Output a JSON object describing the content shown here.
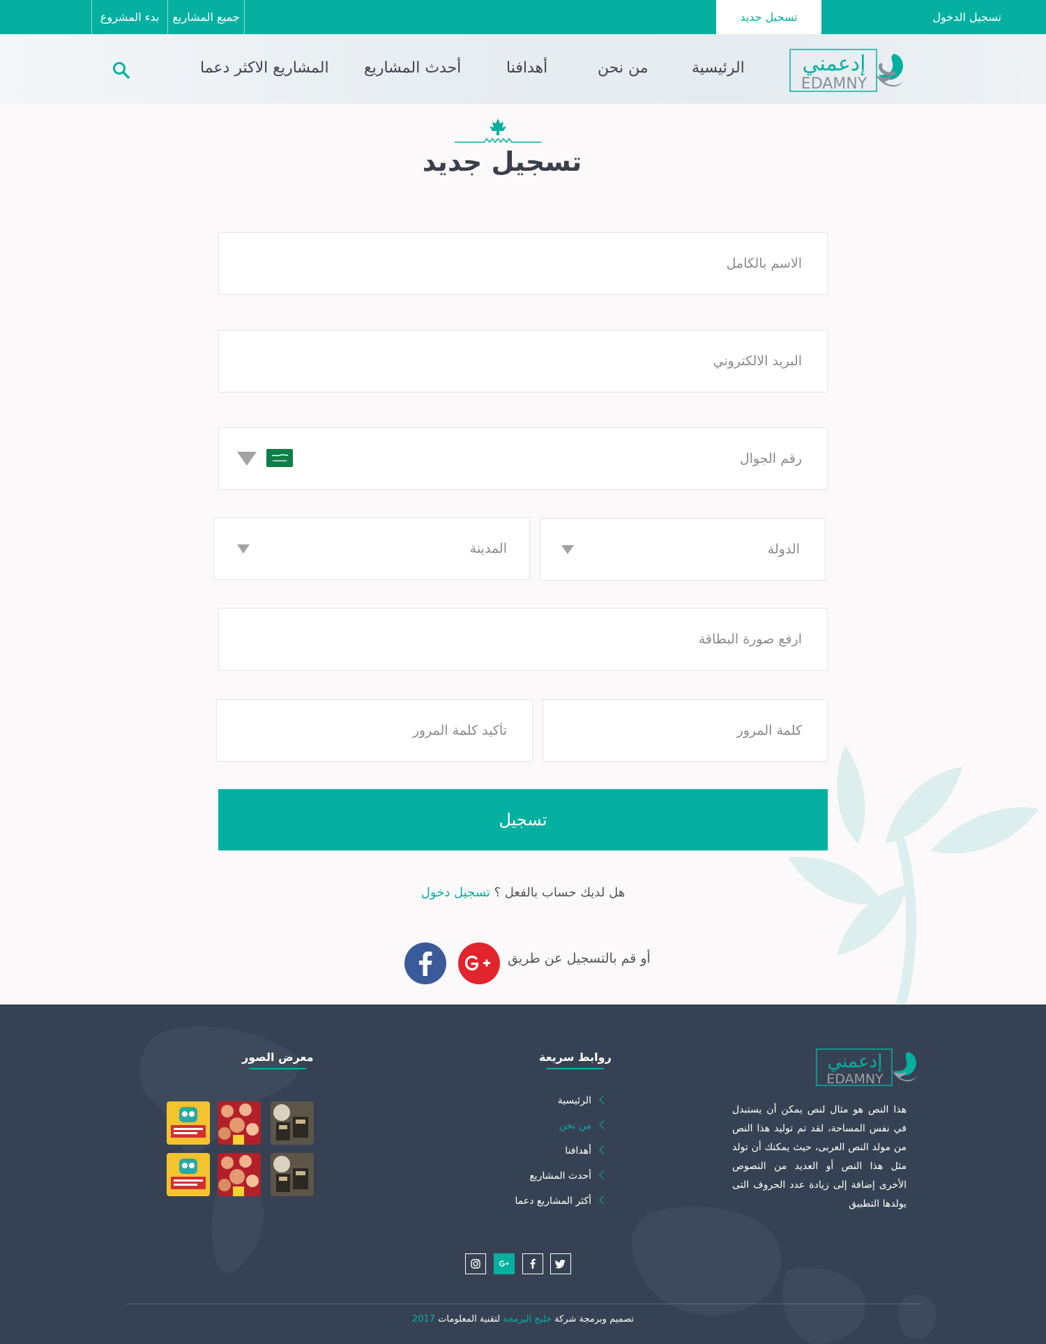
{
  "topbar": {
    "login": "تسجيل الدخول",
    "register": "تسجيل جديد",
    "all_projects": "جميع المشاريع",
    "start_project": "بدء المشروع"
  },
  "brand": {
    "arabic": "إدعمني",
    "latin": "EDAMNY"
  },
  "nav": {
    "home": "الرئيسية",
    "about": "من نحن",
    "goals": "أهدافنا",
    "latest": "أحدث المشاريع",
    "most_supported": "المشاريع الاكثر دعما"
  },
  "form": {
    "title": "تسجيل جديد",
    "full_name": "الاسم بالكامل",
    "email": "البريد الالكتروني",
    "mobile": "رقم الجوال",
    "country": "الدولة",
    "city": "المدينة",
    "upload_card": "ارفع صورة البطاقة",
    "password": "كلمة المرور",
    "confirm_password": "تأكيد كلمة المرور",
    "submit": "تسجيل",
    "have_account": "هل لديك حساب بالفعل ؟",
    "login_link": "تسجيل دخول",
    "social_text": "أو قم بالتسجيل عن طريق"
  },
  "colors": {
    "accent": "#06b0a1",
    "footer_bg": "#364253",
    "google": "#e2242d",
    "facebook": "#3b5a9a"
  },
  "footer": {
    "about_text": "هذا النص هو مثال لنص يمكن أن يستبدل في نفس المساحة، لقد تم توليد هذا النص من مولد النص العربى، حيث يمكنك أن تولد مثل هذا النص أو العديد من النصوص الأخرى إضافة إلى زيادة عدد الحروف التى يولدها التطبيق",
    "quick_links_title": "روابط سريعة",
    "quick_links": [
      "الرئيسية",
      "من نحن",
      "أهدافنا",
      "أحدث المشاريع",
      "أكثر المشاريع دعما"
    ],
    "gallery_title": "معرض الصور",
    "copyright_pre": "تصميم وبرمجة شركة",
    "copyright_company": "خليج البرمجة",
    "copyright_post": "لتقنية المعلومات",
    "copyright_year": "2017"
  }
}
